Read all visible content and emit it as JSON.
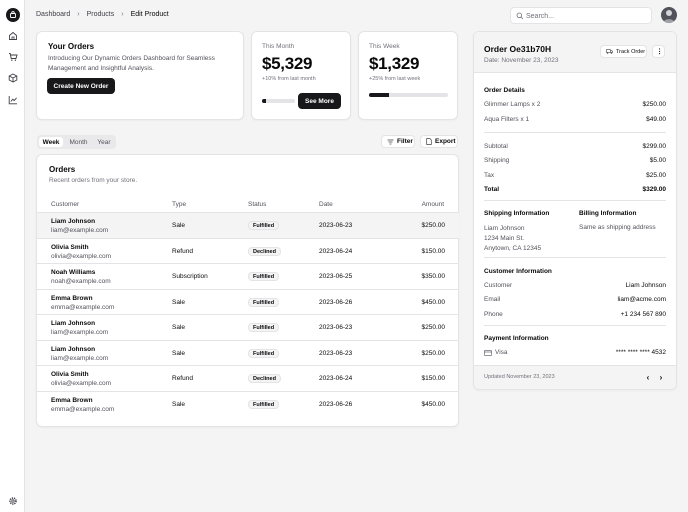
{
  "breadcrumbs": [
    "Dashboard",
    "Products",
    "Edit Product"
  ],
  "search": {
    "placeholder": "Search..."
  },
  "your_orders": {
    "title": "Your Orders",
    "description": "Introducing Our Dynamic Orders Dashboard for Seamless Management and Insightful Analysis.",
    "button": "Create New Order"
  },
  "this_month": {
    "label": "This Month",
    "value": "$5,329",
    "delta": "+10% from last month",
    "button": "See More",
    "progress": 0.12
  },
  "this_week": {
    "label": "This Week",
    "value": "$1,329",
    "delta": "+25% from last week",
    "progress": 0.25
  },
  "tabs": [
    "Week",
    "Month",
    "Year"
  ],
  "actions": {
    "filter": "Filter",
    "export": "Export"
  },
  "orders": {
    "title": "Orders",
    "subtitle": "Recent orders from your store.",
    "columns": [
      "Customer",
      "Type",
      "Status",
      "Date",
      "Amount"
    ],
    "rows": [
      {
        "name": "Liam Johnson",
        "email": "liam@example.com",
        "type": "Sale",
        "status": "Fulfilled",
        "date": "2023-06-23",
        "amount": "$250.00"
      },
      {
        "name": "Olivia Smith",
        "email": "olivia@example.com",
        "type": "Refund",
        "status": "Declined",
        "date": "2023-06-24",
        "amount": "$150.00"
      },
      {
        "name": "Noah Williams",
        "email": "noah@example.com",
        "type": "Subscription",
        "status": "Fulfilled",
        "date": "2023-06-25",
        "amount": "$350.00"
      },
      {
        "name": "Emma Brown",
        "email": "emma@example.com",
        "type": "Sale",
        "status": "Fulfilled",
        "date": "2023-06-26",
        "amount": "$450.00"
      },
      {
        "name": "Liam Johnson",
        "email": "liam@example.com",
        "type": "Sale",
        "status": "Fulfilled",
        "date": "2023-06-23",
        "amount": "$250.00"
      },
      {
        "name": "Liam Johnson",
        "email": "liam@example.com",
        "type": "Sale",
        "status": "Fulfilled",
        "date": "2023-06-23",
        "amount": "$250.00"
      },
      {
        "name": "Olivia Smith",
        "email": "olivia@example.com",
        "type": "Refund",
        "status": "Declined",
        "date": "2023-06-24",
        "amount": "$150.00"
      },
      {
        "name": "Emma Brown",
        "email": "emma@example.com",
        "type": "Sale",
        "status": "Fulfilled",
        "date": "2023-06-26",
        "amount": "$450.00"
      }
    ]
  },
  "order_detail": {
    "title": "Order Oe31b70H",
    "date": "Date: November 23, 2023",
    "track_button": "Track Order",
    "details_heading": "Order Details",
    "items": [
      {
        "label": "Glimmer Lamps x 2",
        "value": "$250.00"
      },
      {
        "label": "Aqua Filters x 1",
        "value": "$49.00"
      }
    ],
    "subtotal": {
      "label": "Subtotal",
      "value": "$299.00"
    },
    "shipping": {
      "label": "Shipping",
      "value": "$5.00"
    },
    "tax": {
      "label": "Tax",
      "value": "$25.00"
    },
    "total": {
      "label": "Total",
      "value": "$329.00"
    },
    "shipping_info": {
      "heading": "Shipping Information",
      "lines": [
        "Liam Johnson",
        "1234 Main St.",
        "Anytown, CA 12345"
      ]
    },
    "billing_info": {
      "heading": "Billing Information",
      "text": "Same as shipping address"
    },
    "customer_info": {
      "heading": "Customer Information",
      "customer": {
        "label": "Customer",
        "value": "Liam Johnson"
      },
      "email": {
        "label": "Email",
        "value": "liam@acme.com"
      },
      "phone": {
        "label": "Phone",
        "value": "+1 234 567 890"
      }
    },
    "payment_info": {
      "heading": "Payment Information",
      "method": "Visa",
      "card": "**** **** **** 4532"
    },
    "updated": "Updated November 23, 2023"
  }
}
